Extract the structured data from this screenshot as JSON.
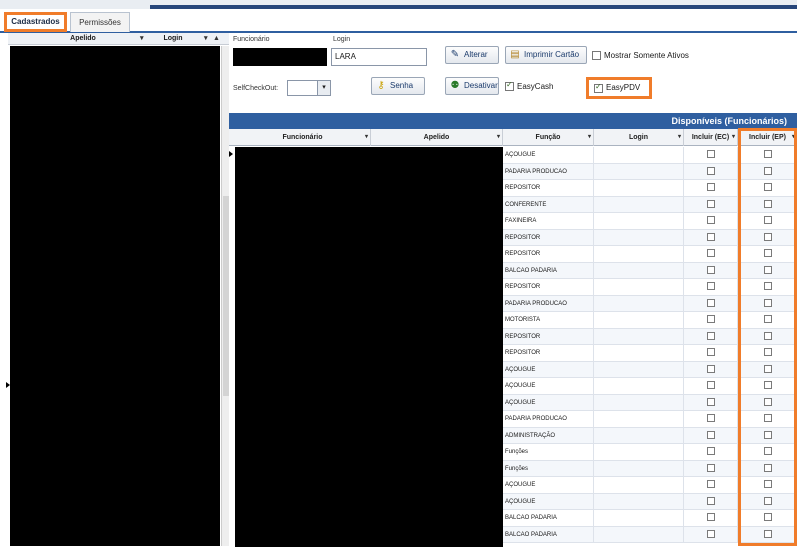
{
  "tabs": [
    {
      "label": "Cadastrados"
    },
    {
      "label": "Permissões"
    }
  ],
  "left_panel": {
    "columns": [
      {
        "label": "Apelido"
      },
      {
        "label": "Login"
      }
    ]
  },
  "form": {
    "funcionario_label": "Funcionário",
    "login_label": "Login",
    "login_value": "LARA",
    "selfcheckout_label": "SelfCheckOut:",
    "buttons": {
      "alterar": "Alterar",
      "imprimir": "Imprimir Cartão",
      "senha": "Senha",
      "desativar": "Desativar"
    },
    "checkboxes": {
      "mostrar_ativos": {
        "label": "Mostrar Somente Ativos",
        "checked": false
      },
      "easycash": {
        "label": "EasyCash",
        "checked": true
      },
      "easypdv": {
        "label": "EasyPDV",
        "checked": true
      }
    }
  },
  "grid": {
    "title": "Disponíveis (Funcionários)",
    "columns": [
      {
        "label": "Funcionário"
      },
      {
        "label": "Apelido"
      },
      {
        "label": "Função"
      },
      {
        "label": "Login"
      },
      {
        "label": "Incluir (EC)"
      },
      {
        "label": "Incluir (EP)"
      }
    ],
    "rows": [
      {
        "funcao": "AÇOUGUE"
      },
      {
        "funcao": "PADARIA PRODUCAO"
      },
      {
        "funcao": "REPOSITOR"
      },
      {
        "funcao": "CONFERENTE"
      },
      {
        "funcao": "FAXINEIRA"
      },
      {
        "funcao": "REPOSITOR"
      },
      {
        "funcao": "REPOSITOR"
      },
      {
        "funcao": "BALCAO PADARIA"
      },
      {
        "funcao": "REPOSITOR"
      },
      {
        "funcao": "PADARIA PRODUCAO"
      },
      {
        "funcao": "MOTORISTA"
      },
      {
        "funcao": "REPOSITOR"
      },
      {
        "funcao": "REPOSITOR"
      },
      {
        "funcao": "AÇOUGUE"
      },
      {
        "funcao": "AÇOUGUE"
      },
      {
        "funcao": "AÇOUGUE"
      },
      {
        "funcao": "PADARIA PRODUCAO"
      },
      {
        "funcao": "ADMINISTRAÇÃO"
      },
      {
        "funcao": "Funções"
      },
      {
        "funcao": "Funções"
      },
      {
        "funcao": "AÇOUGUE"
      },
      {
        "funcao": "AÇOUGUE"
      },
      {
        "funcao": "BALCAO PADARIA"
      },
      {
        "funcao": "BALCAO PADARIA"
      }
    ]
  },
  "colors": {
    "highlight": "#f07c2a",
    "header_blue": "#2f5fa0",
    "top_bar": "#27467a"
  }
}
